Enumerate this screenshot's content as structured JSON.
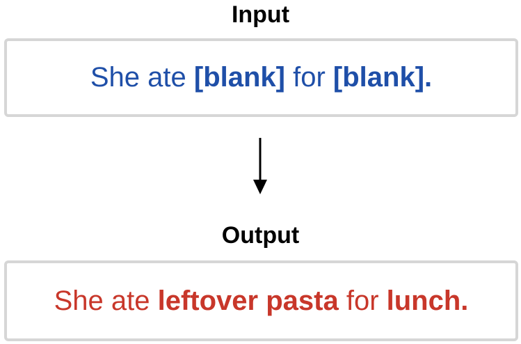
{
  "input": {
    "heading": "Input",
    "color": "#1f4fa8",
    "segments": [
      {
        "text": "She ate ",
        "bold": false
      },
      {
        "text": "[blank]",
        "bold": true
      },
      {
        "text": " for ",
        "bold": false
      },
      {
        "text": "[blank].",
        "bold": true
      }
    ]
  },
  "arrow": {
    "icon": "arrow-down-icon",
    "color": "#000000"
  },
  "output": {
    "heading": "Output",
    "color": "#c8372a",
    "segments": [
      {
        "text": "She ate ",
        "bold": false
      },
      {
        "text": "leftover pasta",
        "bold": true
      },
      {
        "text": " for ",
        "bold": false
      },
      {
        "text": "lunch.",
        "bold": true
      }
    ]
  }
}
